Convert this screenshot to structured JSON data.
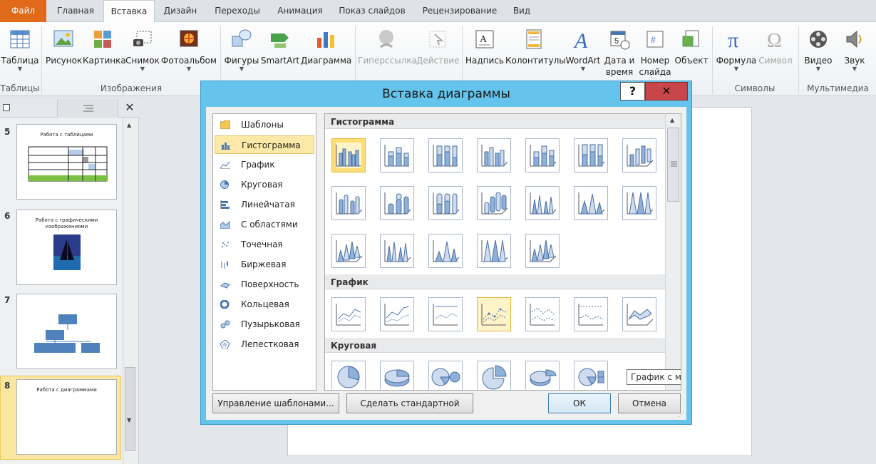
{
  "tabs": [
    "Файл",
    "Главная",
    "Вставка",
    "Дизайн",
    "Переходы",
    "Анимация",
    "Показ слайдов",
    "Рецензирование",
    "Вид"
  ],
  "ribbon": {
    "buttons": [
      {
        "label": "Таблица",
        "icon": "table-icon"
      },
      {
        "label": "Рисунок",
        "icon": "picture-icon"
      },
      {
        "label": "Картинка",
        "icon": "clipart-icon"
      },
      {
        "label": "Снимок",
        "icon": "screenshot-icon"
      },
      {
        "label": "Фотоальбом",
        "icon": "photo-album-icon"
      },
      {
        "label": "Фигуры",
        "icon": "shapes-icon"
      },
      {
        "label": "SmartArt",
        "icon": "smartart-icon"
      },
      {
        "label": "Диаграмма",
        "icon": "chart-icon"
      },
      {
        "label": "Гиперссылка",
        "icon": "hyperlink-icon"
      },
      {
        "label": "Действие",
        "icon": "action-icon"
      },
      {
        "label": "Надпись",
        "icon": "textbox-icon"
      },
      {
        "label": "Колонтитулы",
        "icon": "header-footer-icon"
      },
      {
        "label": "WordArt",
        "icon": "wordart-icon"
      },
      {
        "label1": "Дата и",
        "label2": "время",
        "icon": "date-time-icon"
      },
      {
        "label1": "Номер",
        "label2": "слайда",
        "icon": "slide-number-icon"
      },
      {
        "label": "Объект",
        "icon": "object-icon"
      },
      {
        "label": "Формула",
        "icon": "equation-icon"
      },
      {
        "label": "Символ",
        "icon": "symbol-icon"
      },
      {
        "label": "Видео",
        "icon": "video-icon"
      },
      {
        "label": "Звук",
        "icon": "audio-icon"
      }
    ],
    "groups": [
      "Таблицы",
      "Изображения",
      "Символы",
      "Мультимедиа"
    ]
  },
  "slides": [
    {
      "num": "5",
      "title": "Работа с таблицами"
    },
    {
      "num": "6",
      "title": "Работа с графическими изображениями"
    },
    {
      "num": "7",
      "title": ""
    },
    {
      "num": "8",
      "title": "Работа с диаграммами"
    }
  ],
  "dialog": {
    "title": "Вставка диаграммы",
    "help": "?",
    "close": "✕",
    "categories": [
      "Шаблоны",
      "Гистограмма",
      "График",
      "Круговая",
      "Линейчатая",
      "С областями",
      "Точечная",
      "Биржевая",
      "Поверхность",
      "Кольцевая",
      "Пузырьковая",
      "Лепестковая"
    ],
    "selected_category": "Гистограмма",
    "sections": [
      "Гистограмма",
      "График",
      "Круговая"
    ],
    "tooltip": "График с маркерами",
    "buttons": {
      "manage": "Управление шаблонами...",
      "default": "Сделать стандартной",
      "ok": "ОК",
      "cancel": "Отмена"
    }
  },
  "colors": {
    "file_tab": "#e06a1a",
    "dialog_frame": "#64c4ec",
    "close": "#c8464a",
    "selection": "#fce9a8"
  }
}
